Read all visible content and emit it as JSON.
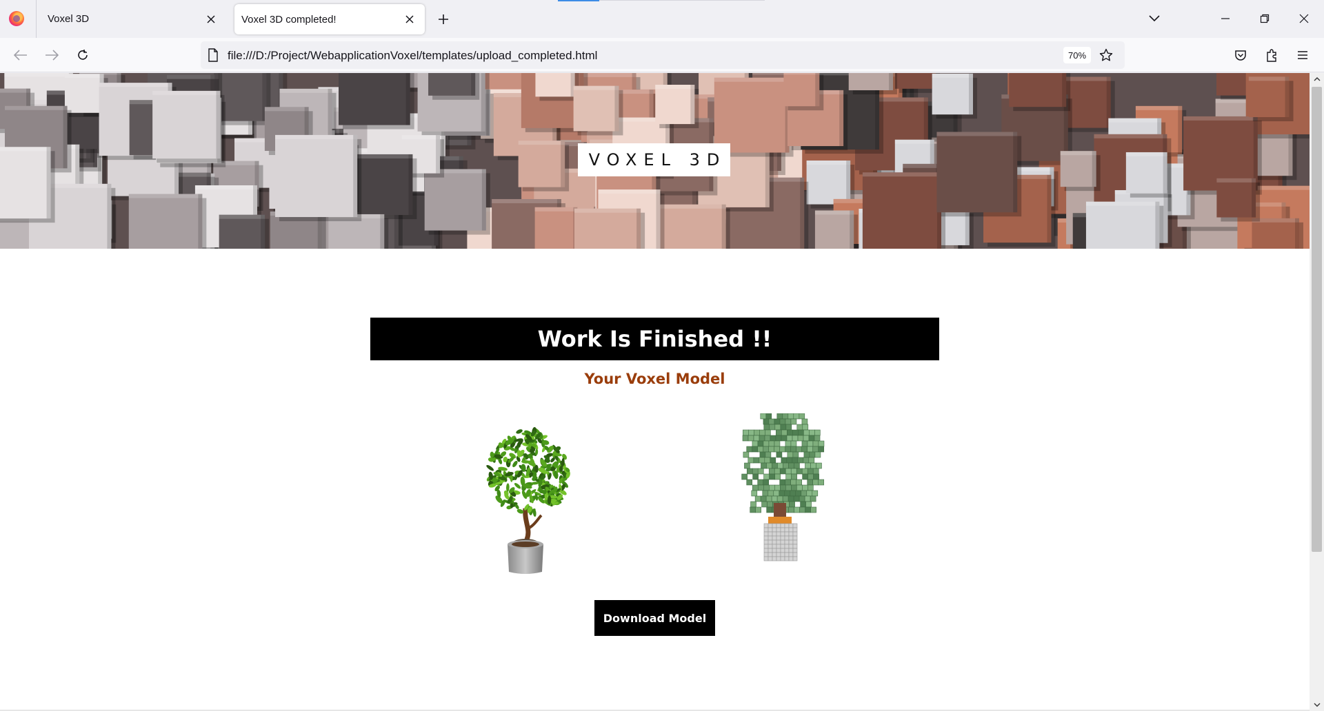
{
  "browser": {
    "tabs": [
      {
        "title": "Voxel 3D",
        "active": false
      },
      {
        "title": "Voxel 3D completed!",
        "active": true
      }
    ],
    "url": "file:///D:/Project/WebapplicationVoxel/templates/upload_completed.html",
    "zoom": "70%",
    "icons": [
      "firefox-icon",
      "close-icon",
      "plus-icon",
      "chevron-down-icon",
      "minimize-icon",
      "restore-icon",
      "window-close-icon",
      "back-arrow-icon",
      "forward-arrow-icon",
      "reload-icon",
      "page-icon",
      "star-icon",
      "pocket-icon",
      "extensions-icon",
      "menu-icon"
    ]
  },
  "page": {
    "brand": "VOXEL 3D",
    "headline": "Work Is Finished !!",
    "subtitle": "Your Voxel Model",
    "download_label": "Download Model",
    "colors": {
      "subtitle": "#9a3d0b",
      "headline_bg": "#000000",
      "button_bg": "#000000"
    }
  }
}
